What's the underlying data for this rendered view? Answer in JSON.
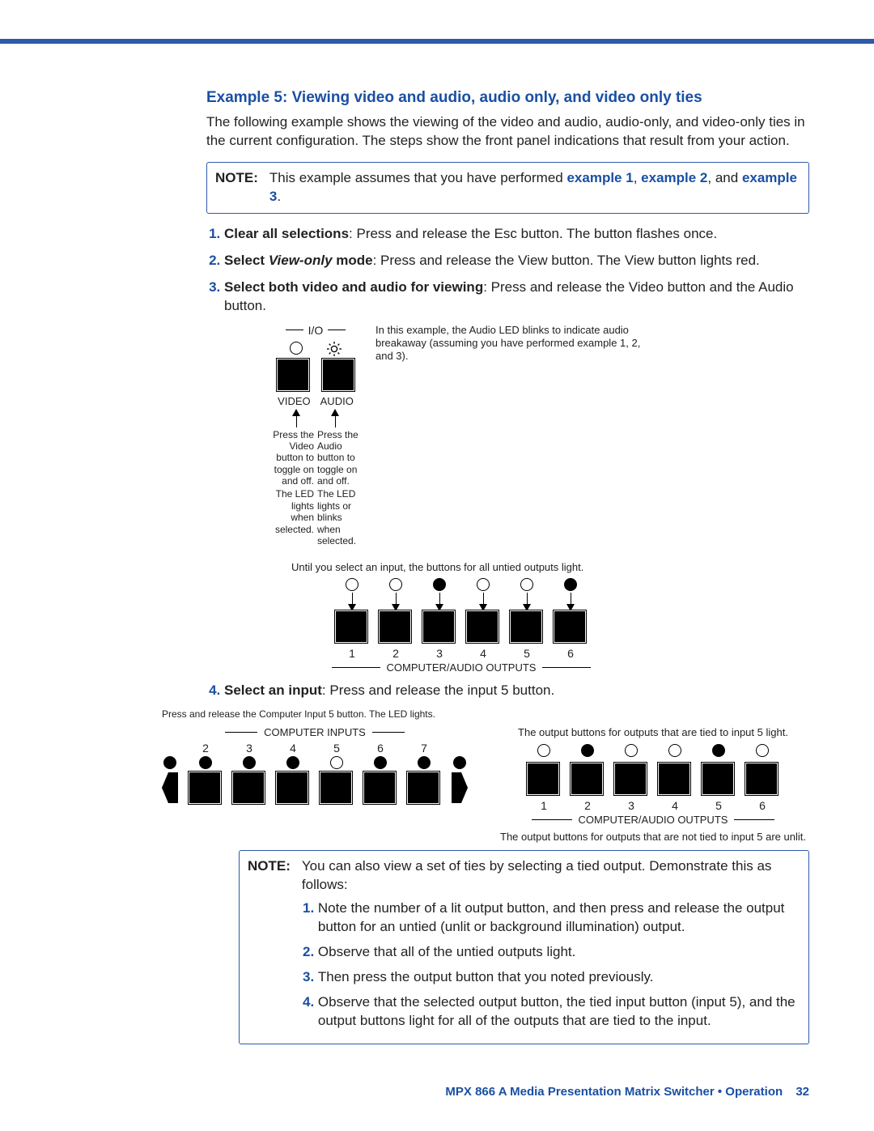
{
  "title": "Example 5: Viewing video and audio, audio only, and video only ties",
  "intro": "The following example shows the viewing of the video and audio, audio-only, and video-only ties in the current configuration. The steps show the front panel indications that result from your action.",
  "note1": {
    "label": "NOTE:",
    "pre": "This example assumes that you have performed ",
    "l1": "example 1",
    "sep1": ", ",
    "l2": "example 2",
    "sep2": ", and ",
    "l3": "example 3",
    "post": "."
  },
  "steps": {
    "s1": {
      "bold": "Clear all selections",
      "rest": ": Press and release the Esc button. The button flashes once."
    },
    "s2": {
      "bold_a": "Select ",
      "ital": "View-only",
      "bold_b": " mode",
      "rest": ": Press and release the View button. The View button lights red."
    },
    "s3": {
      "bold": "Select both video and audio for viewing",
      "rest": ": Press and release the Video button and the Audio button."
    },
    "s4": {
      "bold": "Select an input",
      "rest": ": Press and release the input 5 button."
    }
  },
  "diagram1": {
    "io": "I/O",
    "video": "VIDEO",
    "audio": "AUDIO",
    "side": "In this example, the Audio LED blinks to indicate audio breakaway (assuming you have performed example 1, 2, and 3).",
    "left1": "Press the Video button to toggle on and off.",
    "left2": "The LED lights when selected.",
    "right1": "Press the Audio button to toggle on and off.",
    "right2": "The LED lights or blinks when selected.",
    "until": "Until you select an input, the buttons for all untied outputs light.",
    "out_label": "COMPUTER/AUDIO OUTPUTS",
    "out_numbers": [
      "1",
      "2",
      "3",
      "4",
      "5",
      "6"
    ],
    "out_states": [
      "off",
      "off",
      "on",
      "off",
      "off",
      "on"
    ]
  },
  "diagram2": {
    "pre": "Press and release the Computer Input 5 button. The LED lights.",
    "in_label": "COMPUTER INPUTS",
    "in_numbers": [
      "2",
      "3",
      "4",
      "5",
      "6",
      "7"
    ],
    "in_states": [
      "on",
      "on",
      "on",
      "off",
      "on",
      "on"
    ],
    "in_open_left": true,
    "in_open_right": true,
    "out_caption": "The output buttons for outputs that are tied to input 5 light.",
    "out_label": "COMPUTER/AUDIO OUTPUTS",
    "out_numbers": [
      "1",
      "2",
      "3",
      "4",
      "5",
      "6"
    ],
    "out_states": [
      "off",
      "on",
      "off",
      "off",
      "on",
      "off"
    ],
    "below": "The output buttons for outputs that are not tied to input 5 are unlit."
  },
  "note2": {
    "label": "NOTE:",
    "lead": "You can also view a set of ties by selecting a tied output. Demonstrate this as follows:",
    "items": [
      "Note the number of a lit output button, and then press and release the output button for an untied (unlit or background illumination) output.",
      "Observe that all of the untied outputs light.",
      "Then press the output button that you noted previously.",
      "Observe that the selected output button, the tied input button (input 5), and the output buttons light for all of the outputs that are tied to the input."
    ]
  },
  "footer": {
    "text": "MPX 866 A Media Presentation Matrix Switcher • Operation",
    "page": "32"
  }
}
